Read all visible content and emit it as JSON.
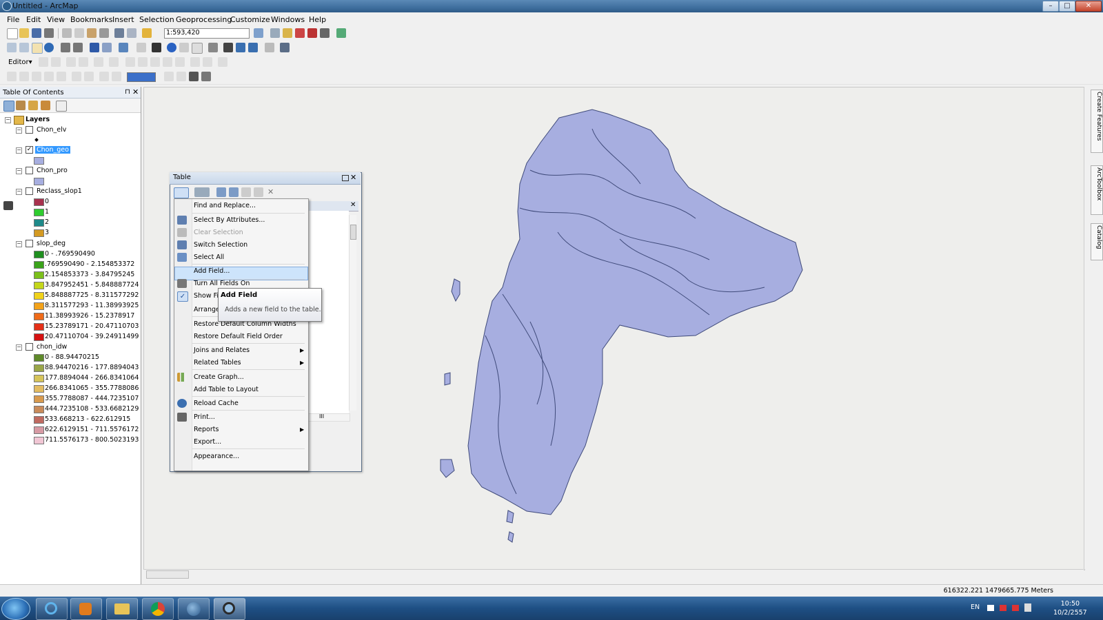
{
  "window": {
    "title": "Untitled - ArcMap",
    "min_label": "–",
    "max_label": "□",
    "close_label": "✕"
  },
  "menubar": [
    "File",
    "Edit",
    "View",
    "Bookmarks",
    "Insert",
    "Selection",
    "Geoprocessing",
    "Customize",
    "Windows",
    "Help"
  ],
  "toolbar": {
    "scale": "1:593,420",
    "editor_label": "Editor▾"
  },
  "toc": {
    "title": "Table Of Contents",
    "root": "Layers",
    "layers": [
      {
        "name": "Chon_elv",
        "checked": false,
        "legend": [
          {
            "label": "",
            "color": "#000000",
            "symbol": "point"
          }
        ]
      },
      {
        "name": "Chon_geo",
        "checked": true,
        "selected": true,
        "legend": [
          {
            "label": "",
            "color": "#a7aee0"
          }
        ]
      },
      {
        "name": "Chon_pro",
        "checked": false,
        "legend": [
          {
            "label": "",
            "color": "#a7aee0"
          }
        ]
      },
      {
        "name": "Reclass_slop1",
        "checked": false,
        "legend": [
          {
            "label": "0",
            "color": "#a8324e"
          },
          {
            "label": "1",
            "color": "#2fcc2f"
          },
          {
            "label": "2",
            "color": "#1f8a8a"
          },
          {
            "label": "3",
            "color": "#d49a22"
          }
        ]
      },
      {
        "name": "slop_deg",
        "checked": false,
        "legend": [
          {
            "label": "0 - .769590490",
            "color": "#1f8f1f"
          },
          {
            "label": ".769590490 - 2.154853372",
            "color": "#3aa31a"
          },
          {
            "label": "2.154853373 - 3.84795245",
            "color": "#7bbf1a"
          },
          {
            "label": "3.847952451 - 5.848887724",
            "color": "#c3d61a"
          },
          {
            "label": "5.848887725 - 8.311577292",
            "color": "#f0d21a"
          },
          {
            "label": "8.311577293 - 11.38993925",
            "color": "#f3a21a"
          },
          {
            "label": "11.38993926 - 15.2378917",
            "color": "#ef6b1a"
          },
          {
            "label": "15.23789171 - 20.47110703",
            "color": "#e43018"
          },
          {
            "label": "20.47110704 - 39.24911499",
            "color": "#d41212"
          }
        ]
      },
      {
        "name": "chon_idw",
        "checked": false,
        "legend": [
          {
            "label": "0 - 88.94470215",
            "color": "#5f8a2a"
          },
          {
            "label": "88.94470216 - 177.8894043",
            "color": "#9aa648"
          },
          {
            "label": "177.8894044 - 266.8341064",
            "color": "#d6c45a"
          },
          {
            "label": "266.8341065 - 355.7788086",
            "color": "#e3bc62"
          },
          {
            "label": "355.7788087 - 444.7235107",
            "color": "#d89a4e"
          },
          {
            "label": "444.7235108 - 533.6682129",
            "color": "#c98b5a"
          },
          {
            "label": "533.668213 - 622.612915",
            "color": "#c06a60"
          },
          {
            "label": "622.6129151 - 711.5576172",
            "color": "#d79aa4"
          },
          {
            "label": "711.5576173 - 800.5023193",
            "color": "#f1c6d4"
          }
        ]
      }
    ]
  },
  "table_window": {
    "title": "Table",
    "scroll_thumb": "III"
  },
  "context_menu": {
    "items": [
      {
        "label": "Find and Replace...",
        "icon": "binoculars-icon"
      },
      {
        "label": "Select By Attributes...",
        "icon": "select-attributes-icon"
      },
      {
        "label": "Clear Selection",
        "icon": "clear-selection-icon",
        "disabled": true
      },
      {
        "label": "Switch Selection",
        "icon": "switch-selection-icon"
      },
      {
        "label": "Select All",
        "icon": "select-all-icon"
      },
      {
        "label": "Add Field...",
        "highlighted": true
      },
      {
        "label": "Turn All Fields On",
        "icon": "fields-icon"
      },
      {
        "label": "Show Fi",
        "icon": "checkmark-icon"
      },
      {
        "label": "Arrange"
      },
      {
        "label": "Restore Default Column Widths"
      },
      {
        "label": "Restore Default Field Order"
      },
      {
        "label": "Joins and Relates",
        "submenu": true
      },
      {
        "label": "Related Tables",
        "submenu": true
      },
      {
        "label": "Create Graph...",
        "icon": "bar-chart-icon"
      },
      {
        "label": "Add Table to Layout"
      },
      {
        "label": "Reload Cache",
        "icon": "refresh-icon"
      },
      {
        "label": "Print...",
        "icon": "printer-icon"
      },
      {
        "label": "Reports",
        "submenu": true
      },
      {
        "label": "Export..."
      },
      {
        "label": "Appearance..."
      }
    ]
  },
  "tooltip": {
    "title": "Add Field",
    "description": "Adds a new field to the table."
  },
  "right_dock": [
    "Create Features",
    "ArcToolbox",
    "Catalog"
  ],
  "status": {
    "coordinates": "616322.221  1479665.775 Meters"
  },
  "taskbar": {
    "language": "EN",
    "time": "10:50",
    "date": "10/2/2557"
  },
  "colors": {
    "map_fill": "#a7aee0",
    "map_stroke": "#3f4a7a",
    "selection": "#3399ff"
  }
}
